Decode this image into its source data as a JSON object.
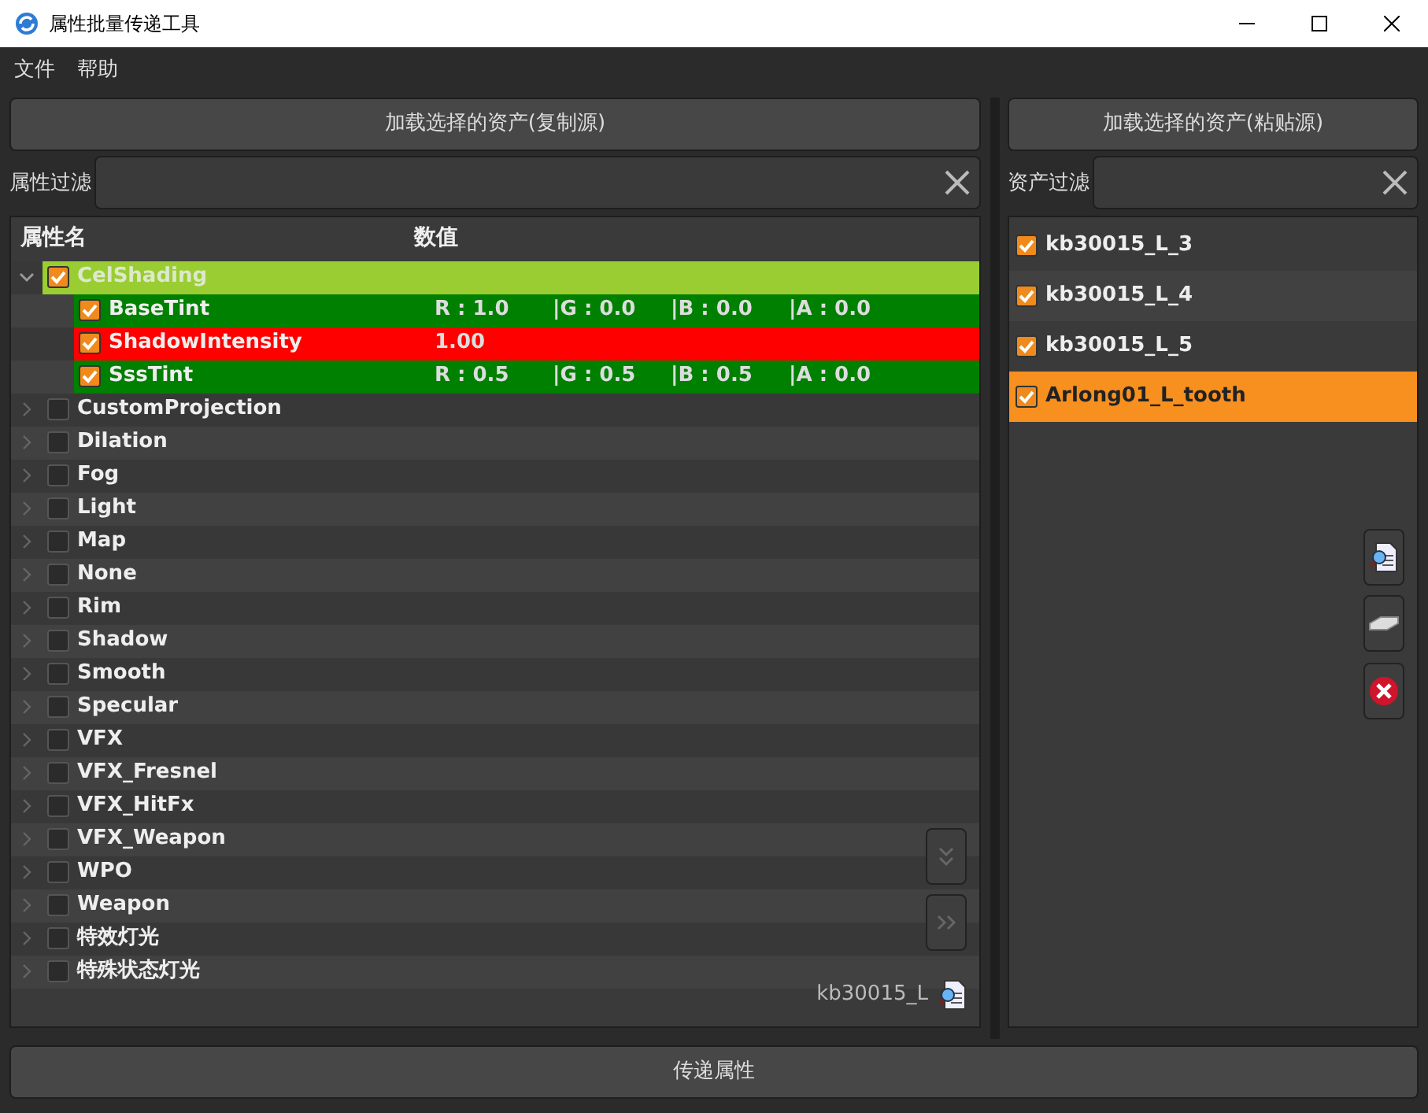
{
  "window": {
    "title": "属性批量传递工具"
  },
  "menu": [
    "文件",
    "帮助"
  ],
  "left": {
    "load_button": "加载选择的资产(复制源)",
    "filter_label": "属性过滤",
    "columns": [
      "属性名",
      "数值"
    ],
    "tree": [
      {
        "name": "CelShading",
        "checked": true,
        "expanded": true,
        "color": "#9acd32",
        "children": [
          {
            "name": "BaseTint",
            "checked": true,
            "color": "#008000",
            "values": [
              "R : 1.0",
              "|G : 0.0",
              "|B : 0.0",
              "|A : 0.0"
            ]
          },
          {
            "name": "ShadowIntensity",
            "checked": true,
            "color": "#ff0000",
            "values": [
              "1.00"
            ]
          },
          {
            "name": "SssTint",
            "checked": true,
            "color": "#008000",
            "values": [
              "R : 0.5",
              "|G : 0.5",
              "|B : 0.5",
              "|A : 0.0"
            ]
          }
        ]
      },
      {
        "name": "CustomProjection",
        "checked": false,
        "expanded": false
      },
      {
        "name": "Dilation",
        "checked": false,
        "expanded": false
      },
      {
        "name": "Fog",
        "checked": false,
        "expanded": false
      },
      {
        "name": "Light",
        "checked": false,
        "expanded": false
      },
      {
        "name": "Map",
        "checked": false,
        "expanded": false
      },
      {
        "name": "None",
        "checked": false,
        "expanded": false
      },
      {
        "name": "Rim",
        "checked": false,
        "expanded": false
      },
      {
        "name": "Shadow",
        "checked": false,
        "expanded": false
      },
      {
        "name": "Smooth",
        "checked": false,
        "expanded": false
      },
      {
        "name": "Specular",
        "checked": false,
        "expanded": false
      },
      {
        "name": "VFX",
        "checked": false,
        "expanded": false
      },
      {
        "name": "VFX_Fresnel",
        "checked": false,
        "expanded": false
      },
      {
        "name": "VFX_HitFx",
        "checked": false,
        "expanded": false
      },
      {
        "name": "VFX_Weapon",
        "checked": false,
        "expanded": false
      },
      {
        "name": "WPO",
        "checked": false,
        "expanded": false
      },
      {
        "name": "Weapon",
        "checked": false,
        "expanded": false
      },
      {
        "name": "特效灯光",
        "checked": false,
        "expanded": false
      },
      {
        "name": "特殊状态灯光",
        "checked": false,
        "expanded": false
      }
    ],
    "source_label": "kb30015_L"
  },
  "right": {
    "load_button": "加载选择的资产(粘贴源)",
    "filter_label": "资产过滤",
    "assets": [
      {
        "name": "kb30015_L_3",
        "checked": true,
        "selected": false
      },
      {
        "name": "kb30015_L_4",
        "checked": true,
        "selected": false
      },
      {
        "name": "kb30015_L_5",
        "checked": true,
        "selected": false
      },
      {
        "name": "Arlong01_L_tooth",
        "checked": true,
        "selected": true
      }
    ]
  },
  "transfer_button": "传递属性"
}
